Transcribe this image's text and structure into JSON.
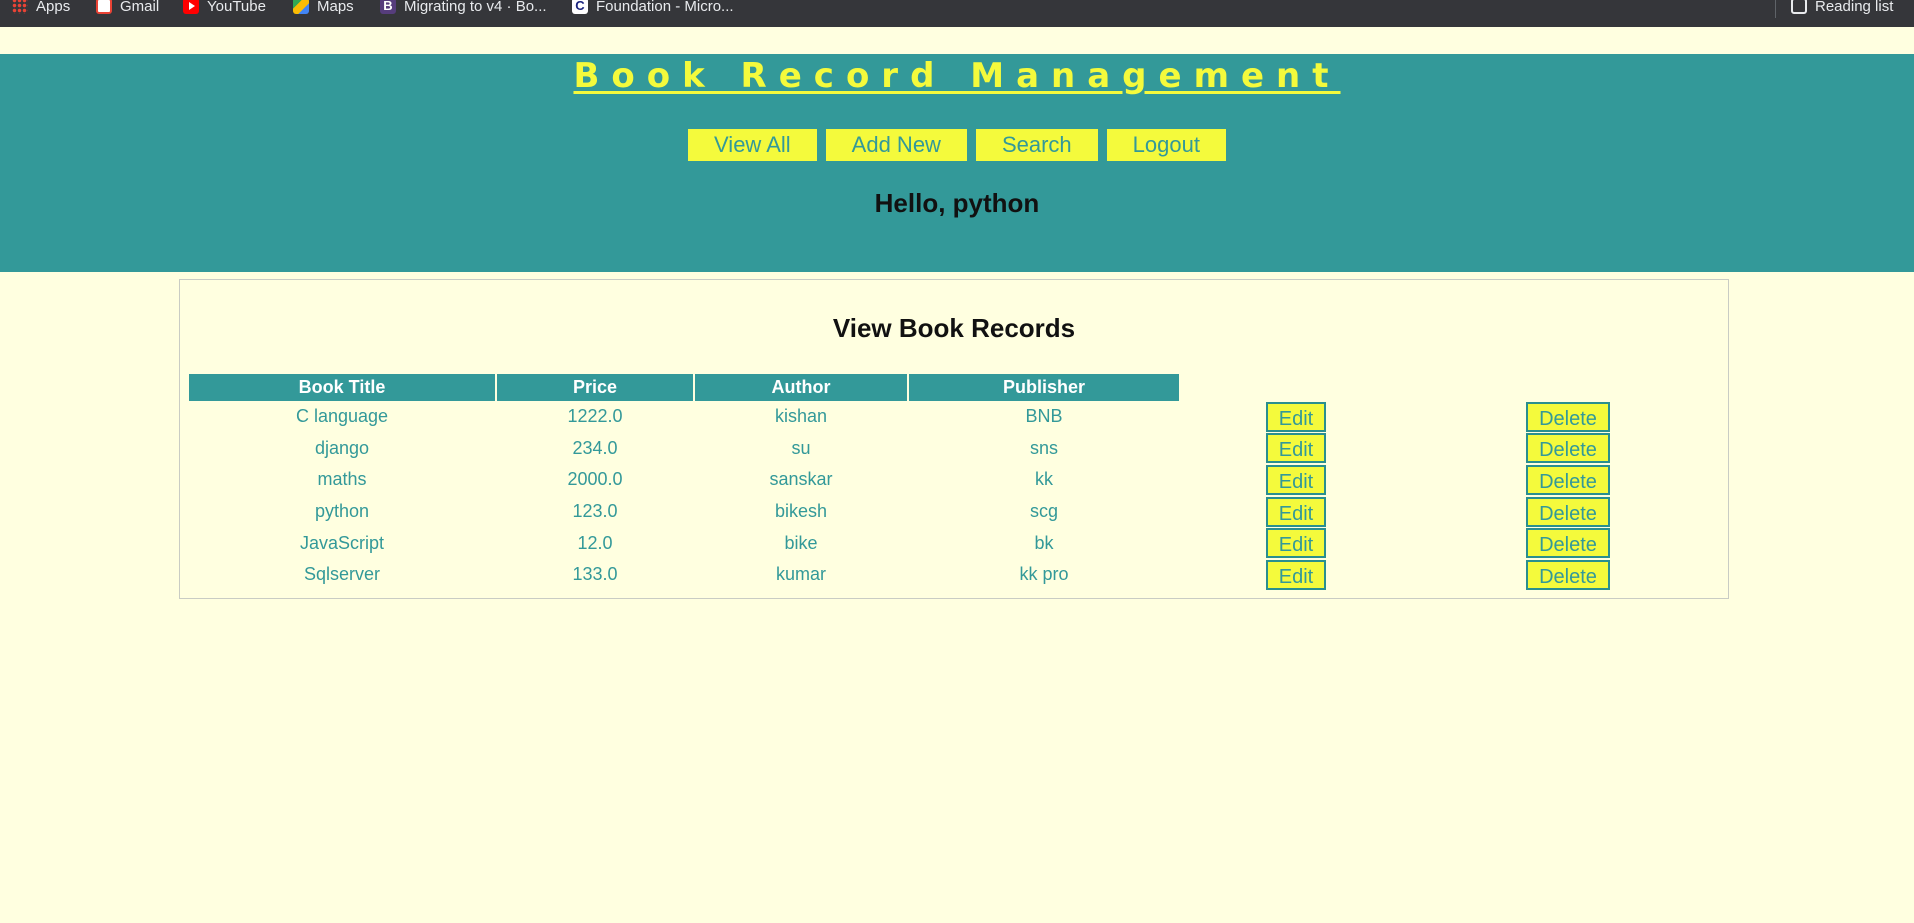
{
  "bookmarks": [
    {
      "label": "Apps",
      "icon": "apps-grid-icon"
    },
    {
      "label": "Gmail",
      "icon": "gmail-icon"
    },
    {
      "label": "YouTube",
      "icon": "youtube-icon"
    },
    {
      "label": "Maps",
      "icon": "maps-icon"
    },
    {
      "label": "Migrating to v4 · Bo...",
      "icon": "bootstrap-icon"
    },
    {
      "label": "Foundation - Micro...",
      "icon": "foundation-icon"
    }
  ],
  "reading_list": {
    "label": "Reading list",
    "icon": "reading-list-icon"
  },
  "header": {
    "title": "Book Record Management",
    "nav": [
      "View All",
      "Add New",
      "Search",
      "Logout"
    ],
    "greeting": "Hello, python"
  },
  "records": {
    "heading": "View Book Records",
    "columns": [
      "Book Title",
      "Price",
      "Author",
      "Publisher"
    ],
    "rows": [
      {
        "title": "C language",
        "price": "1222.0",
        "author": "kishan",
        "publisher": "BNB"
      },
      {
        "title": "django",
        "price": "234.0",
        "author": "su",
        "publisher": "sns"
      },
      {
        "title": "maths",
        "price": "2000.0",
        "author": "sanskar",
        "publisher": "kk"
      },
      {
        "title": "python",
        "price": "123.0",
        "author": "bikesh",
        "publisher": "scg"
      },
      {
        "title": "JavaScript",
        "price": "12.0",
        "author": "bike",
        "publisher": "bk"
      },
      {
        "title": "Sqlserver",
        "price": "133.0",
        "author": "kumar",
        "publisher": "kk pro"
      }
    ],
    "edit_label": "Edit",
    "delete_label": "Delete"
  },
  "colors": {
    "background": "#ffffe0",
    "header_teal": "#339999",
    "accent_yellow": "#f4fa3c"
  }
}
